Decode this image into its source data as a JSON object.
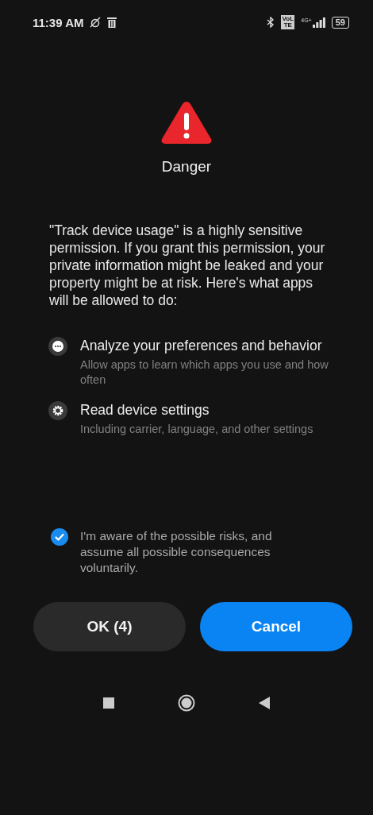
{
  "status_bar": {
    "time": "11:39 AM",
    "volte": "VoLTE",
    "network": "4G+",
    "battery": "59"
  },
  "dialog": {
    "title": "Danger",
    "message": "\"Track device usage\" is a highly sensitive permission. If you grant this permission, your private information might be leaked and your property might be at risk. Here's what apps will be allowed to do:",
    "permissions": [
      {
        "kind": "more",
        "title": "Analyze your preferences and behavior",
        "description": "Allow apps to learn which apps you use and how often"
      },
      {
        "kind": "settings",
        "title": "Read device settings",
        "description": "Including carrier, language, and other settings"
      }
    ],
    "consent": {
      "label": "I'm aware of the possible risks, and assume all possible consequences voluntarily.",
      "checked": true
    },
    "buttons": [
      {
        "label": "OK (4)",
        "kind": "secondary"
      },
      {
        "label": "Cancel",
        "kind": "primary"
      }
    ]
  }
}
